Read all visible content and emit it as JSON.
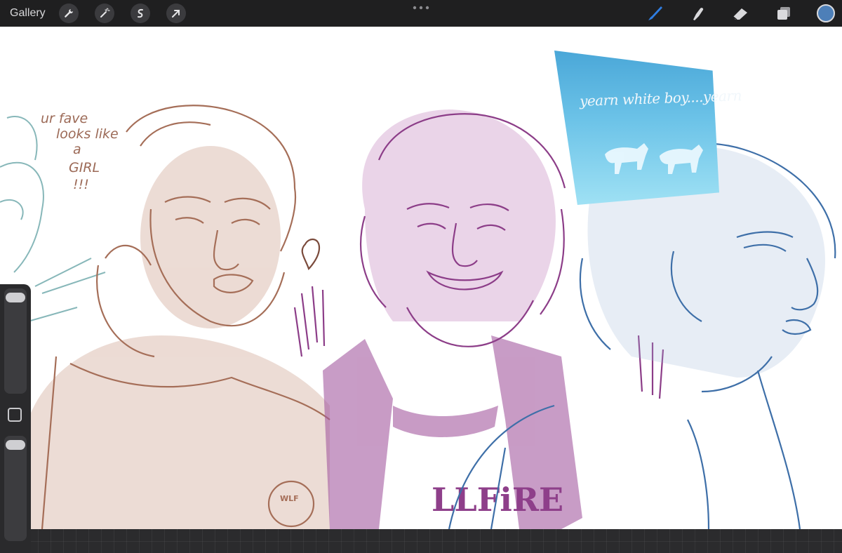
{
  "toolbar": {
    "gallery_label": "Gallery",
    "actions": [
      {
        "name": "wrench-icon"
      },
      {
        "name": "magic-wand-icon"
      },
      {
        "name": "selection-icon"
      },
      {
        "name": "transform-arrow-icon"
      }
    ],
    "tools": [
      {
        "name": "brush-icon",
        "active": true
      },
      {
        "name": "smudge-icon",
        "active": false
      },
      {
        "name": "eraser-icon",
        "active": false
      },
      {
        "name": "layers-icon",
        "active": false
      }
    ],
    "current_color": "#4d7fb8",
    "active_color": "#2f7de1"
  },
  "canvas": {
    "note_lines": [
      "ur fave",
      "looks like",
      "a",
      "GIRL",
      "!!!"
    ],
    "reference_caption": "yearn white boy....yearn",
    "shirt_text": "LLFiRE",
    "patch_text": "WLF"
  },
  "sidebar": {
    "brush_size_icon": "slider-handle",
    "modify_icon": "square-icon"
  }
}
